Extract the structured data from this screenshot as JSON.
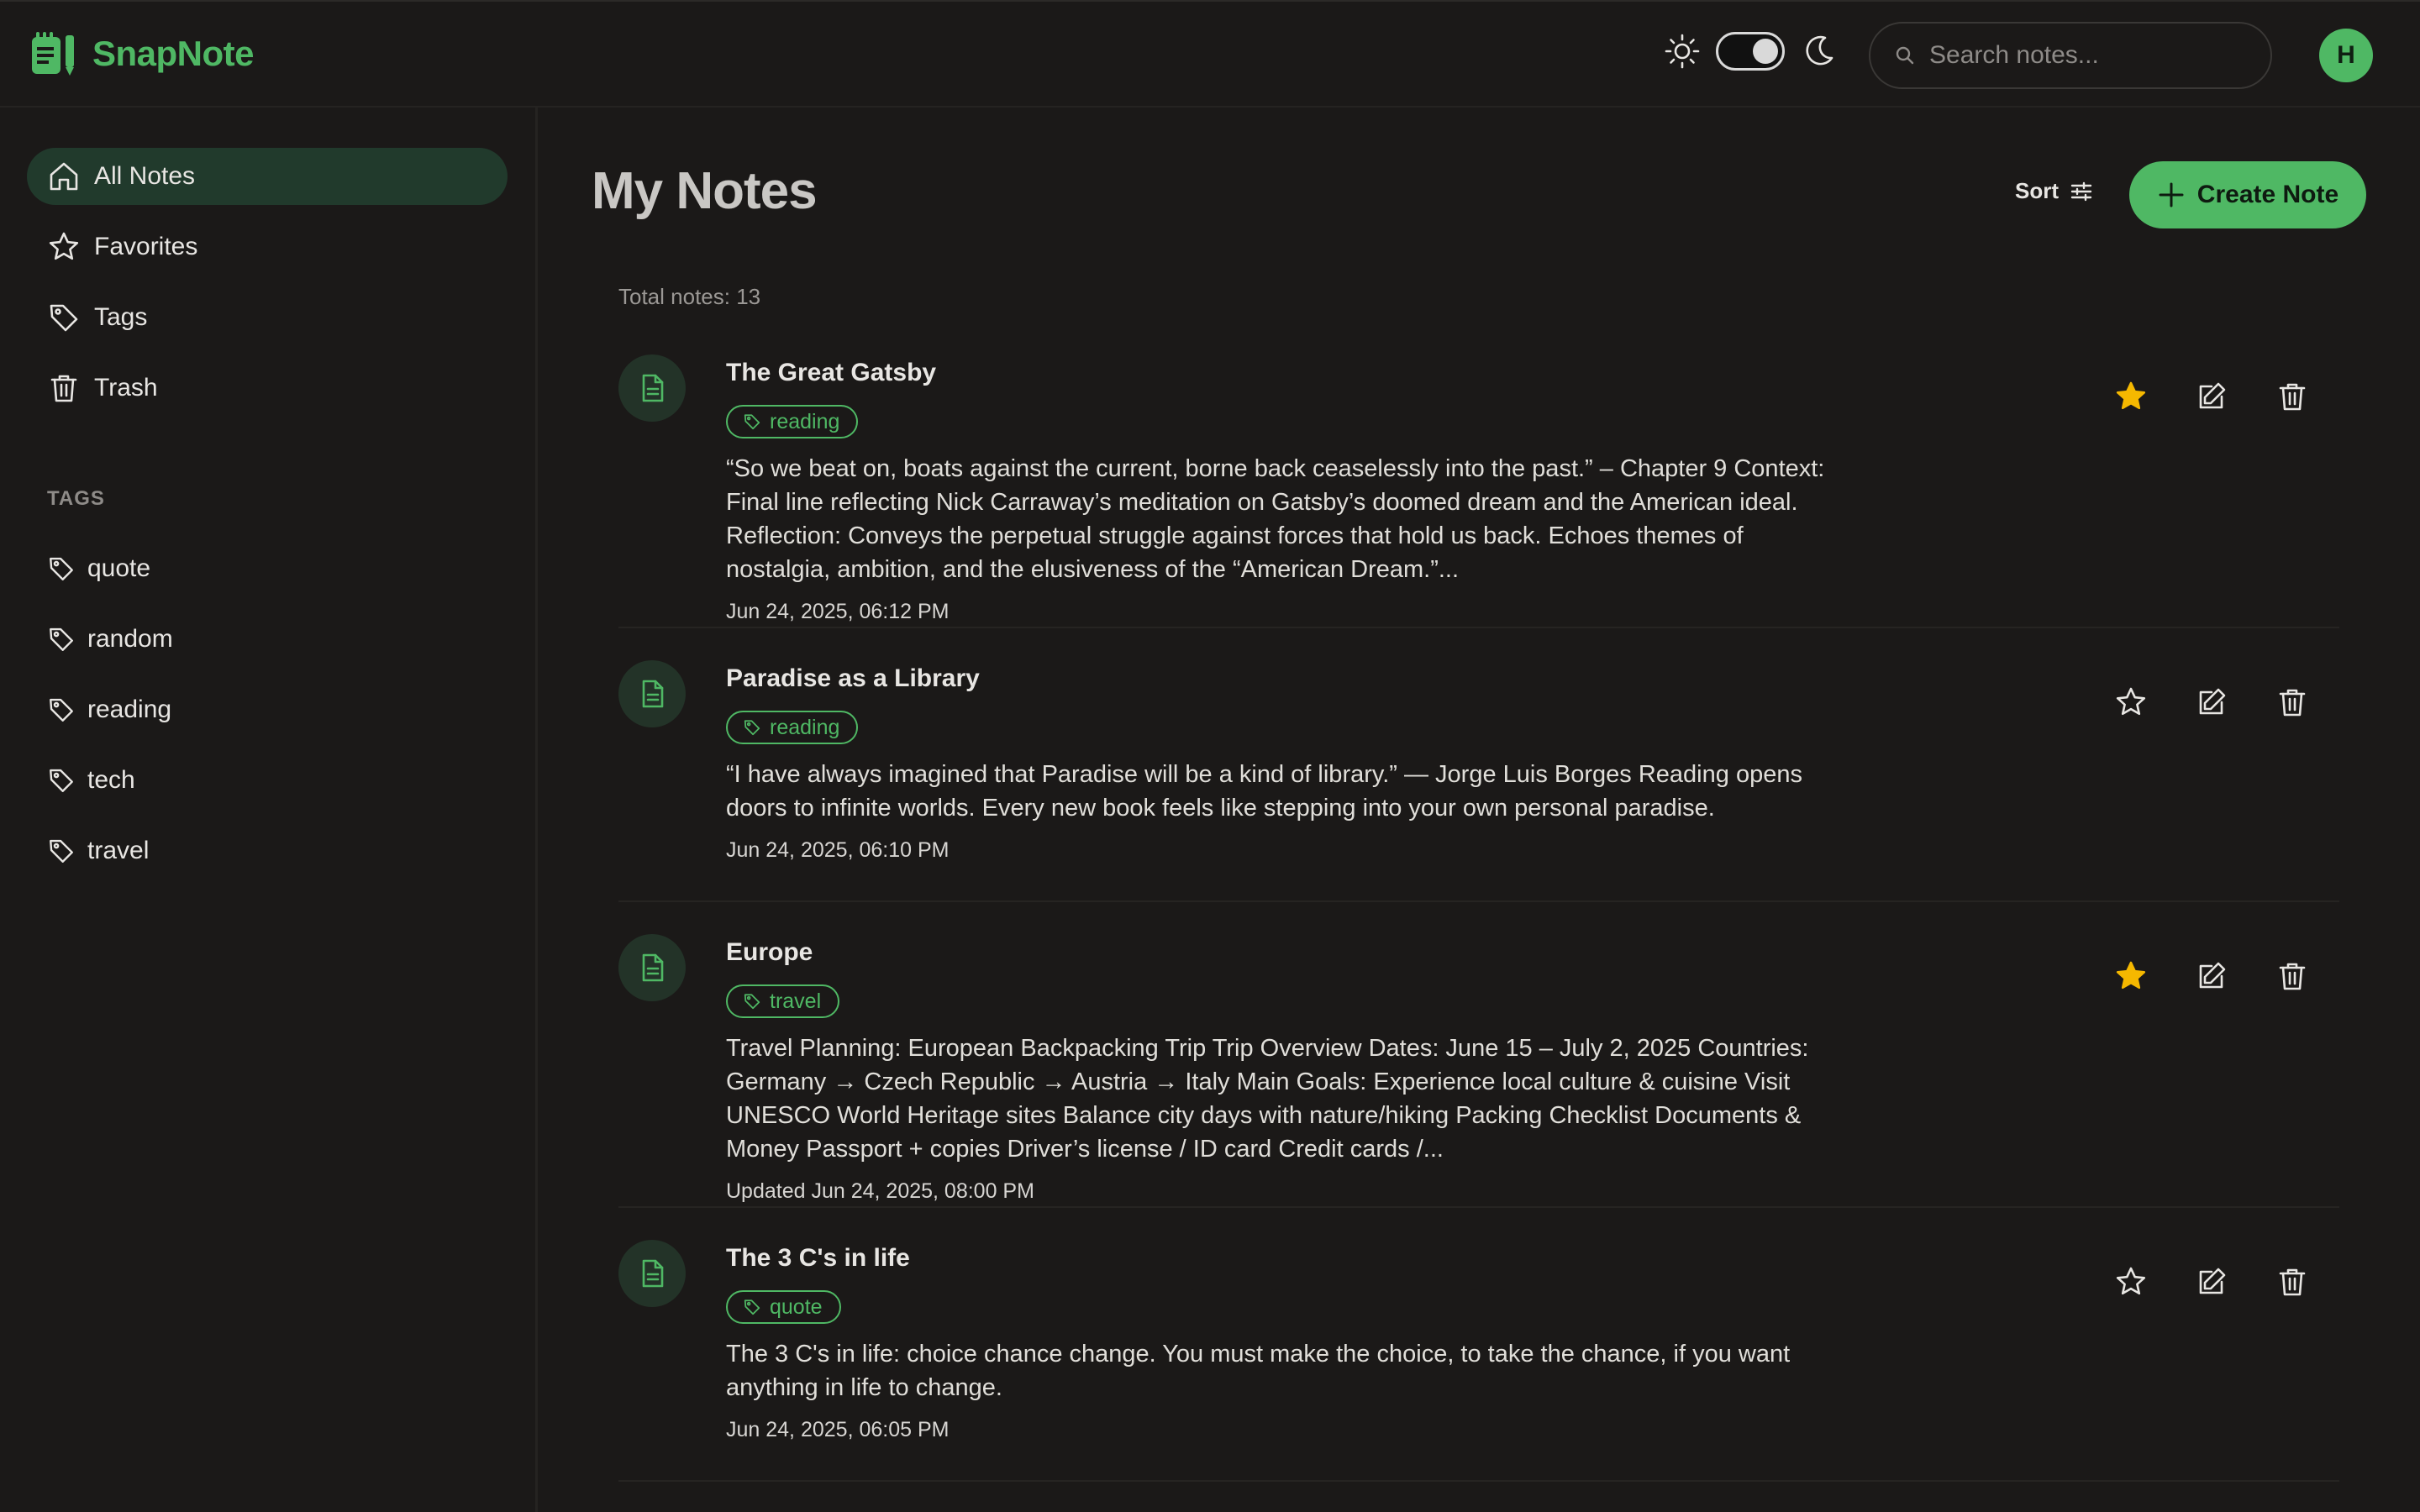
{
  "app": {
    "name": "SnapNote"
  },
  "header": {
    "search_placeholder": "Search notes...",
    "avatar_initial": "H",
    "theme": "dark"
  },
  "sidebar": {
    "items": [
      {
        "label": "All Notes",
        "icon": "home-icon",
        "active": true
      },
      {
        "label": "Favorites",
        "icon": "star-icon",
        "active": false
      },
      {
        "label": "Tags",
        "icon": "tag-icon",
        "active": false
      },
      {
        "label": "Trash",
        "icon": "trash-icon",
        "active": false
      }
    ],
    "tags_heading": "TAGS",
    "tags": [
      "quote",
      "random",
      "reading",
      "tech",
      "travel"
    ]
  },
  "main": {
    "title": "My Notes",
    "sort_label": "Sort",
    "create_label": "Create Note",
    "total": "Total notes: 13",
    "notes": [
      {
        "title": "The Great Gatsby",
        "tag": "reading",
        "text": "“So we beat on, boats against the current, borne back ceaselessly into the past.” – Chapter 9 Context: Final line reflecting Nick Carraway’s meditation on Gatsby’s doomed dream and the American ideal. Reflection: Conveys the perpetual struggle against forces that hold us back. Echoes themes of nostalgia, ambition, and the elusiveness of the “American Dream.”...",
        "date": "Jun 24, 2025, 06:12 PM",
        "favorite": true
      },
      {
        "title": "Paradise as a Library",
        "tag": "reading",
        "text": "“I have always imagined that Paradise will be a kind of library.” — Jorge Luis Borges Reading opens doors to infinite worlds. Every new book feels like stepping into your own personal paradise.",
        "date": "Jun 24, 2025, 06:10 PM",
        "favorite": false
      },
      {
        "title": "Europe",
        "tag": "travel",
        "text": "Travel Planning: European Backpacking Trip Trip Overview Dates: June 15 – July 2, 2025 Countries: Germany → Czech Republic → Austria → Italy Main Goals: Experience local culture & cuisine Visit UNESCO World Heritage sites Balance city days with nature/hiking Packing Checklist Documents & Money Passport + copies Driver’s license / ID card Credit cards /...",
        "date": "Updated Jun 24, 2025, 08:00 PM",
        "favorite": true
      },
      {
        "title": "The 3 C's in life",
        "tag": "quote",
        "text": "The 3 C's in life: choice chance change. You must make the choice, to take the chance, if you want anything in life to change.",
        "date": "Jun 24, 2025, 06:05 PM",
        "favorite": false
      }
    ]
  },
  "colors": {
    "accent": "#4fb864",
    "star": "#f5b800",
    "background": "#1b1918",
    "active_nav": "#213a2c"
  }
}
